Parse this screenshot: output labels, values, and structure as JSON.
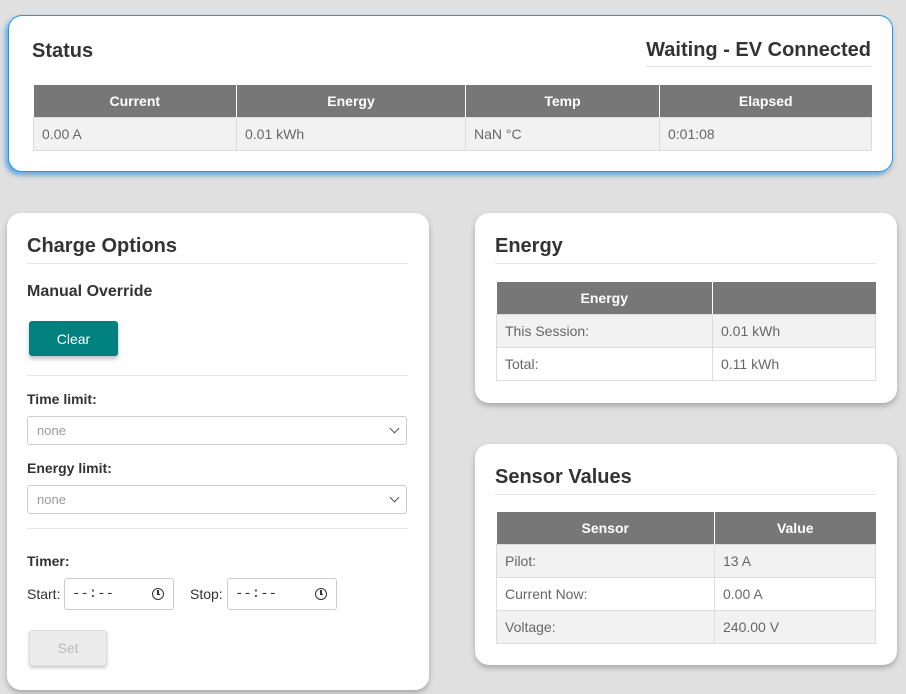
{
  "status": {
    "title": "Status",
    "state": "Waiting - EV Connected",
    "columns": [
      "Current",
      "Energy",
      "Temp",
      "Elapsed"
    ],
    "values": [
      "0.00 A",
      "0.01 kWh",
      "NaN °C",
      "0:01:08"
    ]
  },
  "charge_options": {
    "title": "Charge Options",
    "manual_override_label": "Manual Override",
    "clear_button": "Clear",
    "time_limit_label": "Time limit:",
    "time_limit_value": "none",
    "energy_limit_label": "Energy limit:",
    "energy_limit_value": "none",
    "timer_label": "Timer:",
    "start_label": "Start:",
    "start_value": "--:--",
    "stop_label": "Stop:",
    "stop_value": "--:--",
    "set_button": "Set"
  },
  "energy": {
    "title": "Energy",
    "columns": [
      "Energy",
      ""
    ],
    "rows": [
      [
        "This Session:",
        "0.01 kWh"
      ],
      [
        "Total:",
        "0.11 kWh"
      ]
    ]
  },
  "sensor_values": {
    "title": "Sensor Values",
    "columns": [
      "Sensor",
      "Value"
    ],
    "rows": [
      [
        "Pilot:",
        "13 A"
      ],
      [
        "Current Now:",
        "0.00 A"
      ],
      [
        "Voltage:",
        "240.00 V"
      ]
    ]
  },
  "colors": {
    "status_border": "#2196f3",
    "clear_button": "#00807f",
    "table_header": "#777777",
    "background": "#e0e0e0"
  }
}
